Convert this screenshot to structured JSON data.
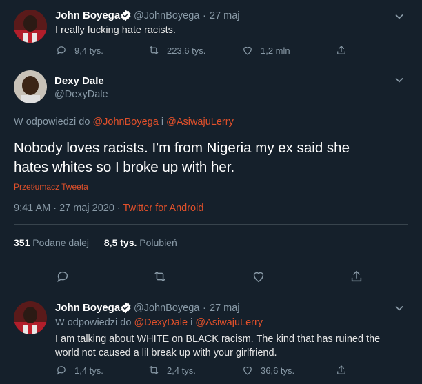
{
  "tweet1": {
    "name": "John Boyega",
    "handle": "@JohnBoyega",
    "dot": "·",
    "date": "27 maj",
    "text": "I really fucking hate racists.",
    "replies": "9,4 tys.",
    "retweets": "223,6 tys.",
    "likes": "1,2 mln"
  },
  "tweet2": {
    "name": "Dexy Dale",
    "handle": "@DexyDale",
    "reply_prefix": "W odpowiedzi do",
    "reply_user1": "@JohnBoyega",
    "reply_and": "i",
    "reply_user2": "@AsiwajuLerry",
    "text_line1": "Nobody loves racists. I'm from Nigeria my ex said she",
    "text_line2": "hates whites so I broke up with her.",
    "translate": "Przetłumacz Tweeta",
    "time": "9:41 AM · 27 maj 2020 ·",
    "source": "Twitter for Android",
    "retweet_count": "351",
    "retweet_label": "Podane dalej",
    "like_count": "8,5 tys.",
    "like_label": "Polubień"
  },
  "tweet3": {
    "name": "John Boyega",
    "handle": "@JohnBoyega",
    "dot": "·",
    "date": "27 maj",
    "reply_prefix": "W odpowiedzi do",
    "reply_user1": "@DexyDale",
    "reply_and": "i",
    "reply_user2": "@AsiwajuLerry",
    "text_line1": "I am talking about WHITE on BLACK racism. The kind that has ruined the",
    "text_line2": "world not caused a lil break up with your girlfriend.",
    "replies": "1,4 tys.",
    "retweets": "2,4 tys.",
    "likes": "36,6 tys."
  },
  "colors": {
    "background": "#15202b",
    "link": "#e0502b",
    "muted": "#8899a6",
    "divider": "#38444d"
  }
}
